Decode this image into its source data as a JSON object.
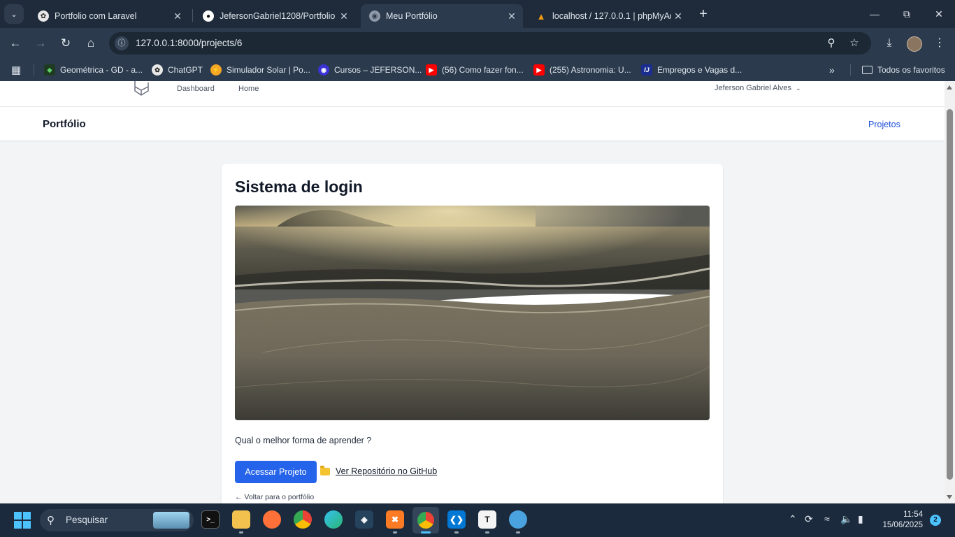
{
  "browser": {
    "tabs": [
      {
        "title": "Portfolio com Laravel",
        "icon": "openai-icon"
      },
      {
        "title": "JefersonGabriel1208/Portfolio",
        "icon": "github-icon"
      },
      {
        "title": "Meu Portfólio",
        "icon": "globe-icon",
        "active": true
      },
      {
        "title": "localhost / 127.0.0.1 | phpMyAd",
        "icon": "phpmyadmin-icon"
      }
    ],
    "url": "127.0.0.1:8000/projects/6",
    "bookmarks": [
      {
        "label": "Geométrica - GD - a...",
        "icon": "geometrica-icon"
      },
      {
        "label": "ChatGPT",
        "icon": "openai-icon"
      },
      {
        "label": "Simulador Solar | Po...",
        "icon": "solar-icon"
      },
      {
        "label": "Cursos – JEFERSON...",
        "icon": "course-icon"
      },
      {
        "label": "(56) Como fazer fon...",
        "icon": "youtube-icon"
      },
      {
        "label": "(255) Astronomia: U...",
        "icon": "youtube-icon"
      },
      {
        "label": "Empregos e Vagas d...",
        "icon": "jobs-icon"
      }
    ],
    "all_bookmarks_label": "Todos os favoritos"
  },
  "app_nav": {
    "links": [
      "Dashboard",
      "Home"
    ],
    "user_name": "Jeferson Gabriel Alves"
  },
  "header": {
    "title": "Portfólio",
    "projects_link": "Projetos"
  },
  "project": {
    "title": "Sistema de login",
    "image_alt": "beach-photo",
    "description": "Qual o melhor forma de aprender ?",
    "primary_button": "Acessar Projeto",
    "repo_link": "Ver Repositório no GitHub",
    "back_link": "← Voltar para o portfólio"
  },
  "taskbar": {
    "search_placeholder": "Pesquisar",
    "time": "11:54",
    "date": "15/06/2025",
    "notifications": "2",
    "apps": [
      "terminal",
      "file-explorer",
      "firefox",
      "chrome",
      "edge",
      "mysql-workbench",
      "xampp",
      "chrome-profile",
      "vscode",
      "typora",
      "app-globe"
    ]
  },
  "colors": {
    "chrome_dark": "#1f2b3a",
    "chrome_toolbar": "#2b3a4c",
    "accent_blue": "#2563eb",
    "link_blue": "#1d4ed8",
    "taskbar": "#1b2a3c"
  }
}
